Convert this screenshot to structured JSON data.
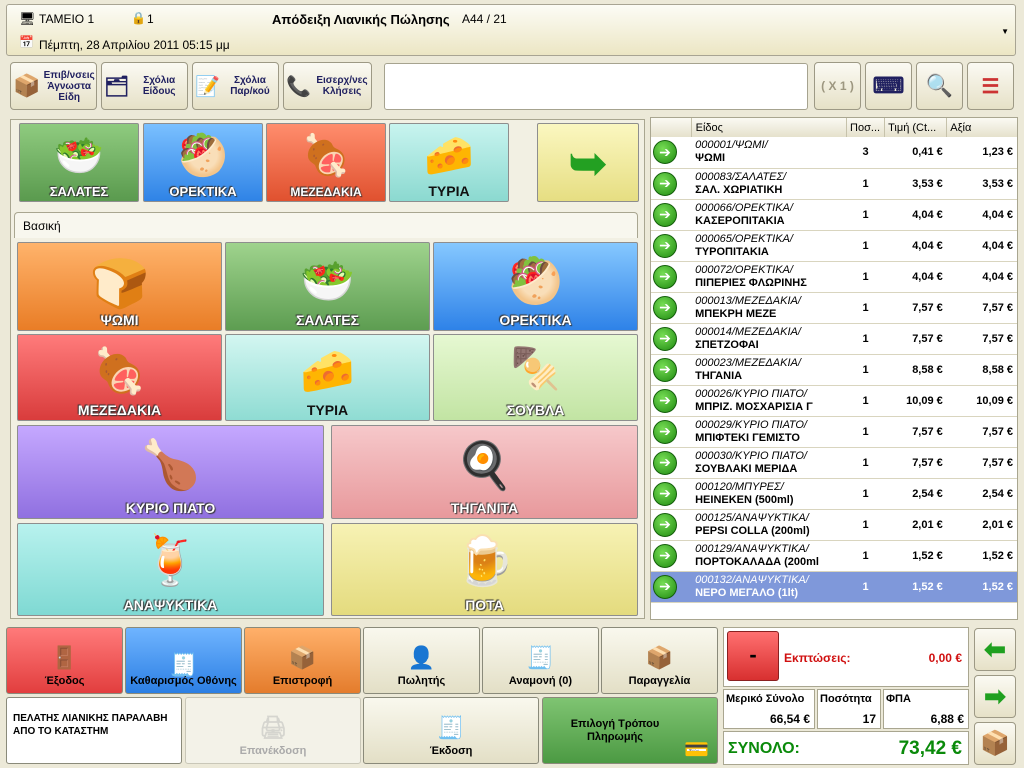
{
  "header": {
    "terminal": "ΤΑΜΕΙΟ 1",
    "user_count": "1",
    "title": "Απόδειξη Λιανικής Πώλησης",
    "doc_no": "Α44 / 21",
    "datetime": "Πέμπτη, 28 Απριλίου 2011 05:15 μμ"
  },
  "toolbar": {
    "unknown_items": "Επιβ/νσεις Άγνωστα Είδη",
    "item_notes": "Σχόλια Είδους",
    "doc_notes": "Σχόλια Παρ/κού",
    "calls": "Εισερχ/νες Κλήσεις",
    "multiplier": "( X 1 )",
    "search_value": ""
  },
  "categories_top": [
    "ΣΑΛΑΤΕΣ",
    "ΟΡΕΚΤΙΚΑ",
    "ΜΕΖΕΔΑΚΙΑ",
    "ΤΥΡΙΑ"
  ],
  "tab": "Βασική",
  "categories": [
    "ΨΩΜΙ",
    "ΣΑΛΑΤΕΣ",
    "ΟΡΕΚΤΙΚΑ",
    "ΜΕΖΕΔΑΚΙΑ",
    "ΤΥΡΙΑ",
    "ΣΟΥΒΛΑ",
    "ΚΥΡΙΟ ΠΙΑΤΟ",
    "ΤΗΓΑΝΙΤΑ",
    "ΑΝΑΨΥΚΤΙΚΑ",
    "ΠΟΤΑ"
  ],
  "list": {
    "headers": [
      "Είδος",
      "Ποσ...",
      "Τιμή (Ct...",
      "Αξία"
    ],
    "rows": [
      {
        "code": "000001/ΨΩΜΙ/",
        "name": "ΨΩΜΙ",
        "qty": "3",
        "price": "0,41 €",
        "value": "1,23 €"
      },
      {
        "code": "000083/ΣΑΛΑΤΕΣ/",
        "name": "ΣΑΛ. ΧΩΡΙΑΤΙΚΗ",
        "qty": "1",
        "price": "3,53 €",
        "value": "3,53 €"
      },
      {
        "code": "000066/ΟΡΕΚΤΙΚΑ/",
        "name": "ΚΑΣΕΡΟΠΙΤΑΚΙΑ",
        "qty": "1",
        "price": "4,04 €",
        "value": "4,04 €"
      },
      {
        "code": "000065/ΟΡΕΚΤΙΚΑ/",
        "name": "ΤΥΡΟΠΙΤΑΚΙΑ",
        "qty": "1",
        "price": "4,04 €",
        "value": "4,04 €"
      },
      {
        "code": "000072/ΟΡΕΚΤΙΚΑ/",
        "name": "ΠΙΠΕΡΙΕΣ ΦΛΩΡΙΝΗΣ",
        "qty": "1",
        "price": "4,04 €",
        "value": "4,04 €"
      },
      {
        "code": "000013/ΜΕΖΕΔΑΚΙΑ/",
        "name": "ΜΠΕΚΡΗ ΜΕΖΕ",
        "qty": "1",
        "price": "7,57 €",
        "value": "7,57 €"
      },
      {
        "code": "000014/ΜΕΖΕΔΑΚΙΑ/",
        "name": "ΣΠΕΤΖΟΦΑΙ",
        "qty": "1",
        "price": "7,57 €",
        "value": "7,57 €"
      },
      {
        "code": "000023/ΜΕΖΕΔΑΚΙΑ/",
        "name": "ΤΗΓΑΝΙΑ",
        "qty": "1",
        "price": "8,58 €",
        "value": "8,58 €"
      },
      {
        "code": "000026/ΚΥΡΙΟ ΠΙΑΤΟ/",
        "name": "ΜΠΡΙΖ. ΜΟΣΧΑΡΙΣΙΑ Γ",
        "qty": "1",
        "price": "10,09 €",
        "value": "10,09 €"
      },
      {
        "code": "000029/ΚΥΡΙΟ ΠΙΑΤΟ/",
        "name": "ΜΠΙΦΤΕΚΙ ΓΕΜΙΣΤΟ",
        "qty": "1",
        "price": "7,57 €",
        "value": "7,57 €"
      },
      {
        "code": "000030/ΚΥΡΙΟ ΠΙΑΤΟ/",
        "name": "ΣΟΥΒΛΑΚΙ ΜΕΡΙΔΑ",
        "qty": "1",
        "price": "7,57 €",
        "value": "7,57 €"
      },
      {
        "code": "000120/ΜΠΥΡΕΣ/",
        "name": "HEINEKEN (500ml)",
        "qty": "1",
        "price": "2,54 €",
        "value": "2,54 €"
      },
      {
        "code": "000125/ΑΝΑΨΥΚΤΙΚΑ/",
        "name": "PEPSI COLLA (200ml)",
        "qty": "1",
        "price": "2,01 €",
        "value": "2,01 €"
      },
      {
        "code": "000129/ΑΝΑΨΥΚΤΙΚΑ/",
        "name": "ΠΟΡΤΟΚΑΛΑΔΑ (200ml",
        "qty": "1",
        "price": "1,52 €",
        "value": "1,52 €"
      },
      {
        "code": "000132/ΑΝΑΨΥΚΤΙΚΑ/",
        "name": "ΝΕΡΟ ΜΕΓΑΛΟ (1lt)",
        "qty": "1",
        "price": "1,52 €",
        "value": "1,52 €"
      }
    ]
  },
  "actions": {
    "exit": "Έξοδος",
    "clear": "Καθαρισμός Οθόνης",
    "return": "Επιστροφή",
    "seller": "Πωλητής",
    "wait": "Αναμονή (0)",
    "orders": "Παραγγελία",
    "reissue": "Επανέκδοση",
    "issue": "Έκδοση",
    "payment": "Επιλογή Τρόπου Πληρωμής"
  },
  "customer": "ΠΕΛΑΤΗΣ ΛΙΑΝΙΚΗΣ ΠΑΡΑΛΑΒΗ ΑΠΟ ΤΟ ΚΑΤΑΣΤΗΜ",
  "totals": {
    "minus": "-",
    "discount_label": "Εκπτώσεις:",
    "discount": "0,00 €",
    "subtotal_label": "Μερικό Σύνολο",
    "subtotal": "66,54 €",
    "qty_label": "Ποσότητα",
    "qty": "17",
    "vat_label": "ΦΠΑ",
    "vat": "6,88 €",
    "total_label": "ΣΥΝΟΛΟ:",
    "total": "73,42 €"
  }
}
